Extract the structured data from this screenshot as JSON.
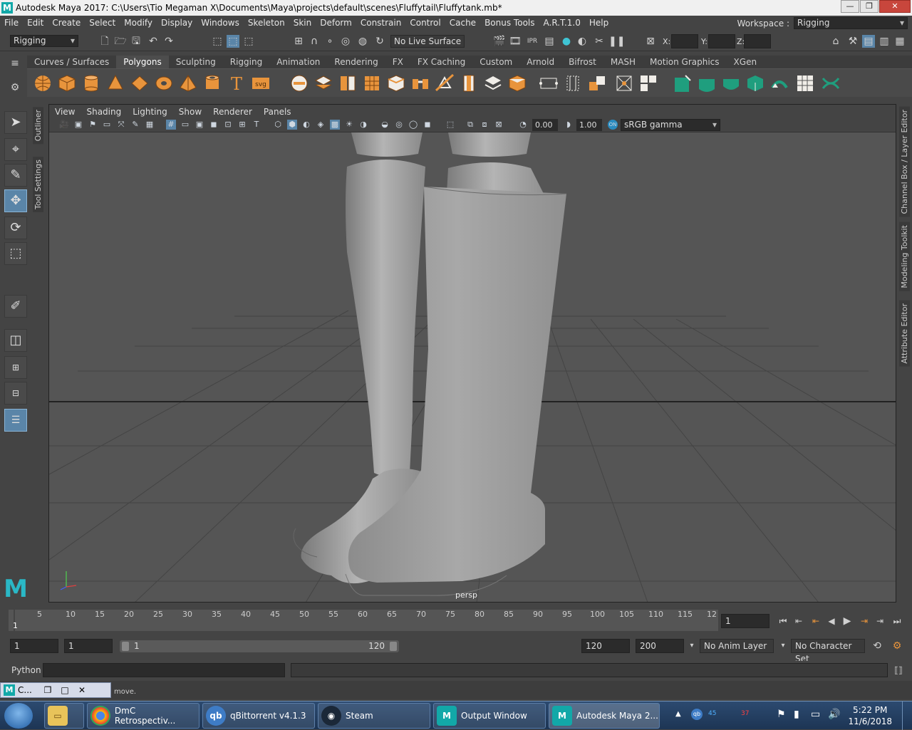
{
  "window": {
    "title": "Autodesk Maya 2017: C:\\Users\\Tio Megaman X\\Documents\\Maya\\projects\\default\\scenes\\Fluffytail\\Fluffytank.mb*",
    "logo": "M"
  },
  "menu": [
    "File",
    "Edit",
    "Create",
    "Select",
    "Modify",
    "Display",
    "Windows",
    "Skeleton",
    "Skin",
    "Deform",
    "Constrain",
    "Control",
    "Cache",
    "Bonus Tools",
    "A.R.T.1.0",
    "Help"
  ],
  "workspace": {
    "label": "Workspace :",
    "value": "Rigging"
  },
  "status": {
    "mode": "Rigging",
    "live_surface": "No Live Surface",
    "x_label": "X:",
    "y_label": "Y:",
    "z_label": "Z:"
  },
  "shelf_tabs": [
    "Curves / Surfaces",
    "Polygons",
    "Sculpting",
    "Rigging",
    "Animation",
    "Rendering",
    "FX",
    "FX Caching",
    "Custom",
    "Arnold",
    "Bifrost",
    "MASH",
    "Motion Graphics",
    "XGen"
  ],
  "shelf_active": "Polygons",
  "shelf_icons": [
    "sphere-icon",
    "cube-icon",
    "cylinder-icon",
    "cone-icon",
    "plane-icon",
    "torus-icon",
    "pyramid-icon",
    "pipe-icon",
    "type-icon",
    "svg-icon",
    "combine-icon",
    "separate-icon",
    "extract-icon",
    "smooth-icon",
    "bevel-icon",
    "bridge-icon",
    "extrude-icon",
    "fill-hole-icon",
    "multi-cut-icon",
    "insert-edge-loop-icon",
    "merge-icon",
    "target-weld-icon",
    "uv-layout-icon",
    "planar-map-icon",
    "texture-editor-icon",
    "wrap-icon",
    "symmetry-icon",
    "mirror-icon",
    "retopo-icon",
    "quad-draw-icon",
    "bind-icon",
    "joint-icon"
  ],
  "side_tabs": {
    "outliner": "Outliner",
    "tool_settings": "Tool Settings",
    "channel_box": "Channel Box / Layer Editor",
    "modeling_toolkit": "Modeling Toolkit",
    "attribute_editor": "Attribute Editor"
  },
  "panel_menu": [
    "View",
    "Shading",
    "Lighting",
    "Show",
    "Renderer",
    "Panels"
  ],
  "viewport": {
    "exposure": "0.00",
    "gamma": "1.00",
    "color_space": "sRGB gamma",
    "camera": "persp"
  },
  "timeline": {
    "ticks": [
      "5",
      "10",
      "15",
      "20",
      "25",
      "30",
      "35",
      "40",
      "45",
      "50",
      "55",
      "60",
      "65",
      "70",
      "75",
      "80",
      "85",
      "90",
      "95",
      "100",
      "105",
      "110",
      "115",
      "12"
    ],
    "current_marker": "1",
    "current_frame": "1"
  },
  "range": {
    "start": "1",
    "inner_start": "1",
    "slider_start": "1",
    "slider_end": "120",
    "inner_end": "120",
    "end": "200",
    "anim_layer": "No Anim Layer",
    "character_set": "No Character Set"
  },
  "command": {
    "label": "Python"
  },
  "help": {
    "text": "move."
  },
  "mini_window": {
    "title": "C..."
  },
  "taskbar": {
    "items": [
      {
        "label": "DmC Retrospectiv...",
        "icon": "chrome-icon"
      },
      {
        "label": "qBittorrent v4.1.3",
        "icon": "qbittorrent-icon"
      },
      {
        "label": "Steam",
        "icon": "steam-icon"
      },
      {
        "label": "Output Window",
        "icon": "maya-icon"
      },
      {
        "label": "Autodesk Maya 2...",
        "icon": "maya-icon"
      }
    ],
    "tray_numbers": [
      "45",
      "37"
    ],
    "time": "5:22 PM",
    "date": "11/6/2018"
  }
}
